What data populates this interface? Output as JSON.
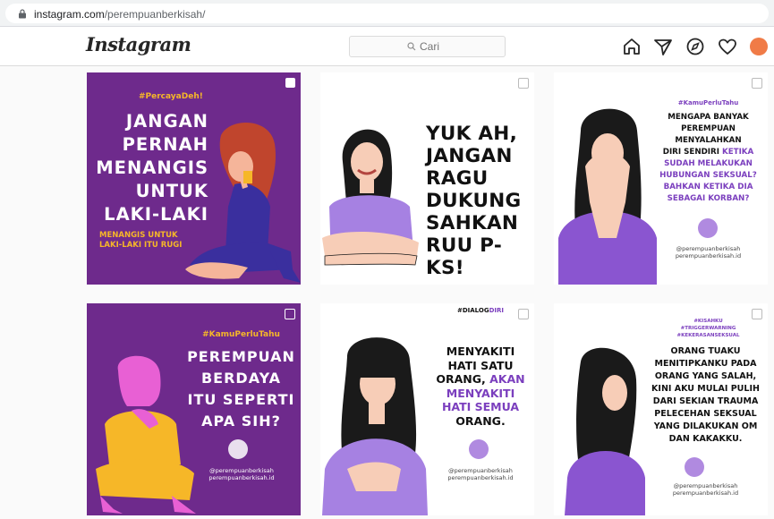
{
  "browser": {
    "url_host": "instagram.com",
    "url_path": "/perempuanberkisah/"
  },
  "header": {
    "logo": "Instagram",
    "search_placeholder": "Cari"
  },
  "icons": [
    "lock-icon",
    "search-icon",
    "home-icon",
    "direct-icon",
    "explore-icon",
    "heart-icon",
    "avatar"
  ],
  "posts": [
    {
      "hashtag": "#PercayaDeh!",
      "line1": "JANGAN",
      "line2": "PERNAH",
      "line3": "MENANGIS",
      "line4": "UNTUK",
      "line5": "LAKI-LAKI",
      "sub1": "MENANGIS UNTUK",
      "sub2": "LAKI-LAKI ITU RUGI"
    },
    {
      "line1": "YUK AH,",
      "line2": "JANGAN",
      "line3": "RAGU",
      "line4": "DUKUNG",
      "line5": "SAHKAN",
      "line6": "RUU P-KS!"
    },
    {
      "hashtag": "#KamuPerluTahu",
      "l1": "MENGAPA BANYAK",
      "l2": "PEREMPUAN",
      "l3": "MENYALAHKAN",
      "l4a": "DIRI SENDIRI ",
      "l4b": "KETIKA",
      "l5": "SUDAH MELAKUKAN",
      "l6": "HUBUNGAN SEKSUAL?",
      "l7": "BAHKAN KETIKA DIA",
      "l8": "SEBAGAI KORBAN?",
      "handle1": "@perempuanberkisah",
      "handle2": "perempuanberkisah.id"
    },
    {
      "hashtag": "#KamuPerluTahu",
      "line1": "PEREMPUAN",
      "line2": "BERDAYA",
      "line3": "ITU SEPERTI",
      "line4": "APA SIH?",
      "handle1": "@perempuanberkisah",
      "handle2": "perempuanberkisah.id"
    },
    {
      "tag_a": "#DIALOG",
      "tag_b": "DIRI",
      "l1": "MENYAKITI",
      "l2": "HATI SATU",
      "l3a": "ORANG, ",
      "l3b": "AKAN",
      "l4": "MENYAKITI",
      "l5": "HATI SEMUA",
      "l6": "ORANG.",
      "handle1": "@perempuanberkisah",
      "handle2": "perempuanberkisah.id"
    },
    {
      "tag1": "#KISAHKU",
      "tag2": "#TRIGGERWARNING",
      "tag3": "#KEKERASANSEKSUAL",
      "l1": "ORANG TUAKU",
      "l2": "MENITIPKANKU PADA",
      "l3": "ORANG YANG SALAH,",
      "l4": "KINI AKU MULAI PULIH",
      "l5": "DARI SEKIAN TRAUMA",
      "l6": "PELECEHAN SEKSUAL",
      "l7": "YANG DILAKUKAN OM",
      "l8": "DAN KAKAKKU.",
      "handle1": "@perempuanberkisah",
      "handle2": "perempuanberkisah.id"
    }
  ],
  "colors": {
    "purple": "#6e2a8c",
    "yellow": "#f6b728",
    "lavender": "#b08ae0",
    "accent_text": "#7b3fbe"
  }
}
